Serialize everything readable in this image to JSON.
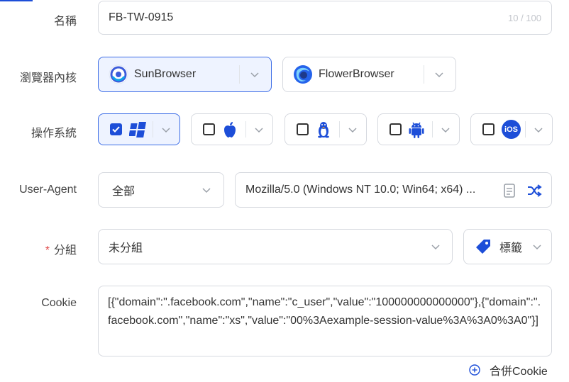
{
  "form": {
    "name": {
      "label": "名稱",
      "value": "FB-TW-0915",
      "counter": "10 / 100"
    },
    "browser": {
      "label": "瀏覽器內核",
      "options": [
        {
          "name": "SunBrowser",
          "selected": true
        },
        {
          "name": "FlowerBrowser",
          "selected": false
        }
      ]
    },
    "os": {
      "label": "操作系統",
      "options": [
        {
          "icon": "windows-icon",
          "checked": true
        },
        {
          "icon": "apple-icon",
          "checked": false
        },
        {
          "icon": "linux-icon",
          "checked": false
        },
        {
          "icon": "android-icon",
          "checked": false
        },
        {
          "icon": "ios-icon",
          "badge": "iOS",
          "checked": false
        }
      ]
    },
    "user_agent": {
      "label": "User-Agent",
      "filter": "全部",
      "value": "Mozilla/5.0 (Windows NT 10.0; Win64; x64) ..."
    },
    "group": {
      "label": "分組",
      "required_mark": "*",
      "value": "未分組",
      "tag_label": "標籤"
    },
    "cookie": {
      "label": "Cookie",
      "value": "[{\"domain\":\".facebook.com\",\"name\":\"c_user\",\"value\":\"100000000000000\"},{\"domain\":\".facebook.com\",\"name\":\"xs\",\"value\":\"00%3Aexample-session-value%3A%3A0%3A0\"}]",
      "merge_label": "合併Cookie"
    }
  },
  "colors": {
    "accent": "#1d4ed8",
    "selected_bg": "#eef3ff",
    "required": "#e04a4a"
  }
}
